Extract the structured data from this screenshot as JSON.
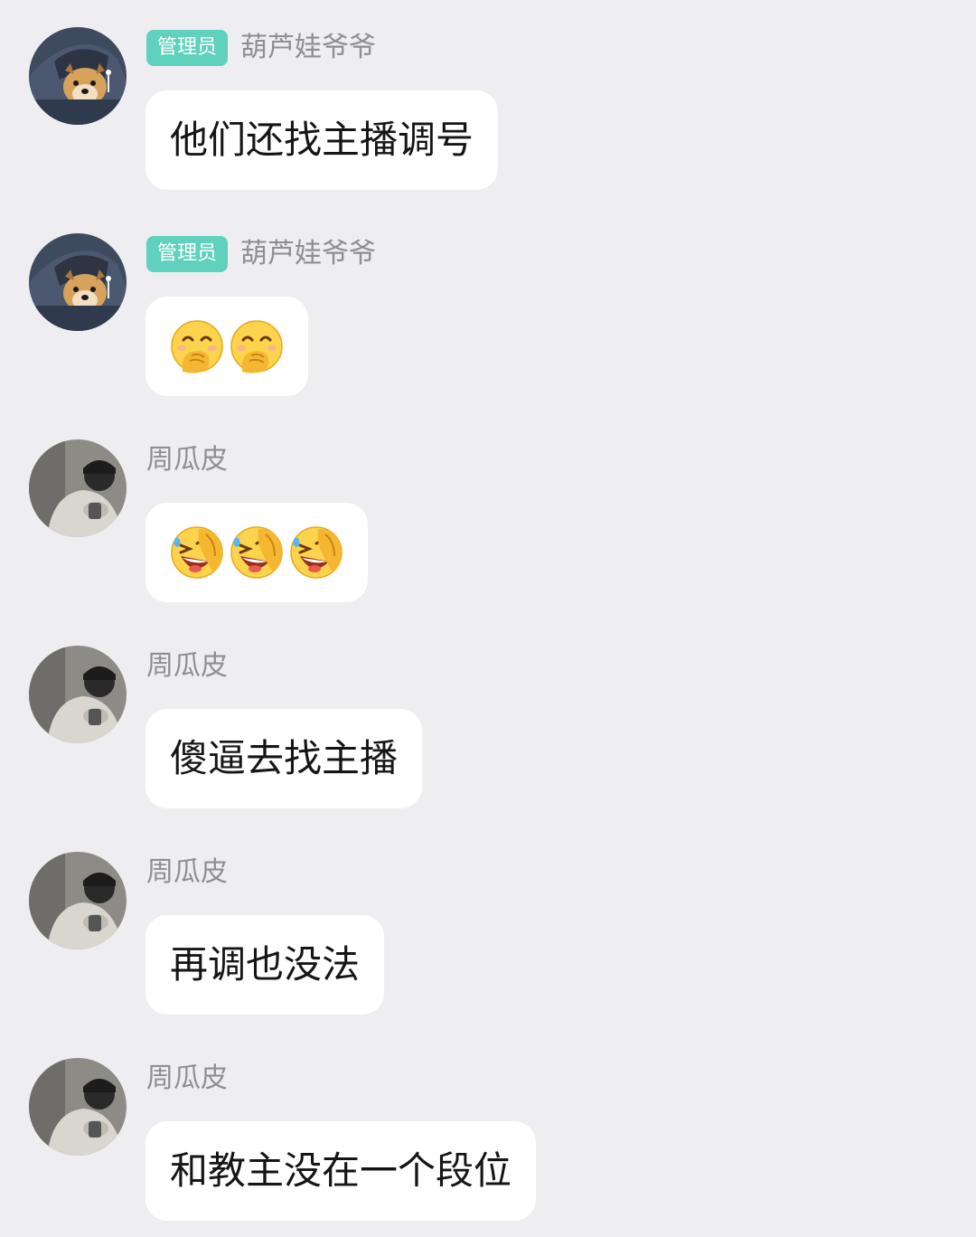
{
  "messages": [
    {
      "avatar_icon": "dog-in-hood-avatar",
      "badge": "管理员",
      "sender": "葫芦娃爷爷",
      "text": "他们还找主播调号",
      "emojis": []
    },
    {
      "avatar_icon": "dog-in-hood-avatar",
      "badge": "管理员",
      "sender": "葫芦娃爷爷",
      "text": "",
      "emojis": [
        "hand-over-mouth-emoji",
        "hand-over-mouth-emoji"
      ]
    },
    {
      "avatar_icon": "person-in-cap-avatar",
      "badge": "",
      "sender": "周瓜皮",
      "text": "",
      "emojis": [
        "laughing-tears-emoji",
        "laughing-tears-emoji",
        "laughing-tears-emoji"
      ]
    },
    {
      "avatar_icon": "person-in-cap-avatar",
      "badge": "",
      "sender": "周瓜皮",
      "text": "傻逼去找主播",
      "emojis": []
    },
    {
      "avatar_icon": "person-in-cap-avatar",
      "badge": "",
      "sender": "周瓜皮",
      "text": "再调也没法",
      "emojis": []
    },
    {
      "avatar_icon": "person-in-cap-avatar",
      "badge": "",
      "sender": "周瓜皮",
      "text": "和教主没在一个段位",
      "emojis": []
    }
  ],
  "colors": {
    "background": "#eeeef1",
    "bubble": "#ffffff",
    "badge": "#5fd1bc",
    "sender_text": "#8e8e93",
    "message_text": "#151515"
  }
}
